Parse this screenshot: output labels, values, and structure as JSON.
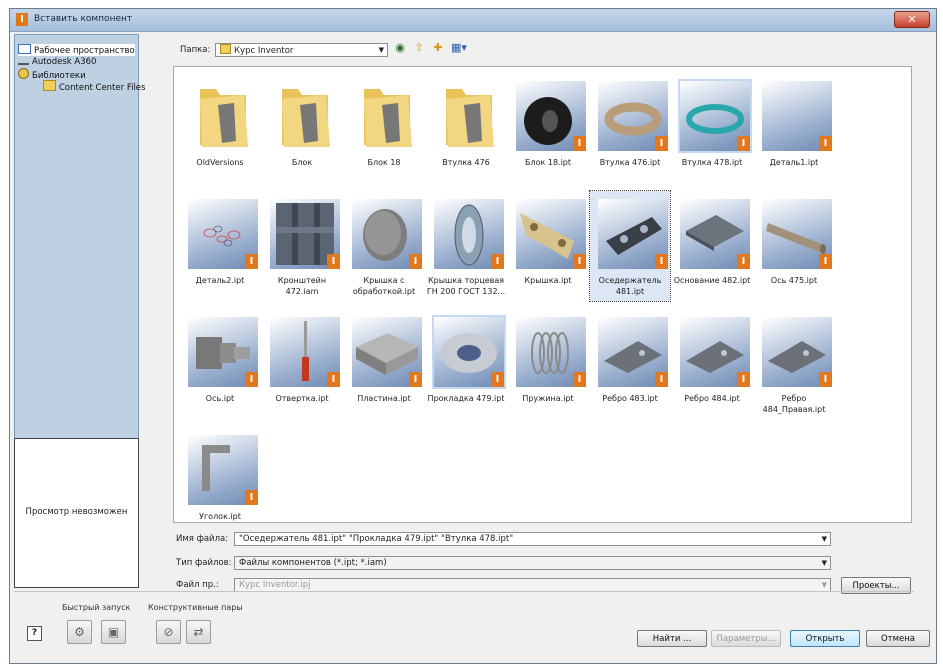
{
  "window": {
    "title": "Вставить компонент",
    "close_icon": "close-icon"
  },
  "locations": [
    {
      "label": "Рабочее пространство",
      "icon": "workspace-icon",
      "selected": true
    },
    {
      "label": "Autodesk A360",
      "icon": "cloud-icon"
    },
    {
      "label": "Библиотеки",
      "icon": "libraries-icon"
    },
    {
      "label": "Content Center Files",
      "icon": "folder-icon"
    }
  ],
  "preview": {
    "text": "Просмотр невозможен"
  },
  "folder": {
    "label": "Папка:",
    "value": "Курс Inventor"
  },
  "items": [
    {
      "label": "OldVersions",
      "kind": "folder"
    },
    {
      "label": "Блок",
      "kind": "folder"
    },
    {
      "label": "Блок 18",
      "kind": "folder"
    },
    {
      "label": "Втулка 476",
      "kind": "folder"
    },
    {
      "label": "Блок 18.ipt",
      "kind": "file",
      "shape": "wheel"
    },
    {
      "label": "Втулка 476.ipt",
      "kind": "file",
      "shape": "ring-tan"
    },
    {
      "label": "Втулка 478.ipt",
      "kind": "file",
      "shape": "ring-teal",
      "highlight": true
    },
    {
      "label": "Деталь1.ipt",
      "kind": "file",
      "shape": "empty"
    },
    {
      "label": "Деталь2.ipt",
      "kind": "file",
      "shape": "sketch"
    },
    {
      "label": "Кронштейн 472.iam",
      "kind": "file",
      "shape": "bracket"
    },
    {
      "label": "Крышка с обработкой.ipt",
      "kind": "file",
      "shape": "disc"
    },
    {
      "label": "Крышка торцевая ГН 200 ГОСТ 132...",
      "kind": "file",
      "shape": "cover"
    },
    {
      "label": "Крышка.ipt",
      "kind": "file",
      "shape": "plate-tan"
    },
    {
      "label": "Оседержатель 481.ipt",
      "kind": "file",
      "shape": "holder",
      "selected": true
    },
    {
      "label": "Основание 482.ipt",
      "kind": "file",
      "shape": "base"
    },
    {
      "label": "Ось 475.ipt",
      "kind": "file",
      "shape": "shaft"
    },
    {
      "label": "Ось.ipt",
      "kind": "file",
      "shape": "axle"
    },
    {
      "label": "Отвертка.ipt",
      "kind": "file",
      "shape": "screwdriver"
    },
    {
      "label": "Пластина.ipt",
      "kind": "file",
      "shape": "block"
    },
    {
      "label": "Прокладка 479.ipt",
      "kind": "file",
      "shape": "gasket",
      "highlight": true
    },
    {
      "label": "Пружина.ipt",
      "kind": "file",
      "shape": "spring"
    },
    {
      "label": "Ребро 483.ipt",
      "kind": "file",
      "shape": "rib"
    },
    {
      "label": "Ребро 484.ipt",
      "kind": "file",
      "shape": "rib"
    },
    {
      "label": "Ребро 484_Правая.ipt",
      "kind": "file",
      "shape": "rib"
    },
    {
      "label": "Уголок.ipt",
      "kind": "file",
      "shape": "angle"
    }
  ],
  "filename": {
    "label": "Имя файла:",
    "value": "\"Оседержатель 481.ipt\" \"Прокладка 479.ipt\" \"Втулка 478.ipt\""
  },
  "filetype": {
    "label": "Тип файлов:",
    "value": "Файлы компонентов (*.ipt; *.iam)"
  },
  "project": {
    "label": "Файл пр.:",
    "value": "Курс Inventor.ipj",
    "button": "Проекты..."
  },
  "quick_launch": {
    "title": "Быстрый запуск"
  },
  "constraint_pairs": {
    "title": "Конструктивные пары"
  },
  "buttons": {
    "find": "Найти ...",
    "params": "Параметры...",
    "open": "Открыть",
    "cancel": "Отмена",
    "help": "?"
  },
  "colors": {
    "title_bar": "#b4c8e1",
    "left_panel": "#bed1e2",
    "badge": "#e2781e"
  }
}
